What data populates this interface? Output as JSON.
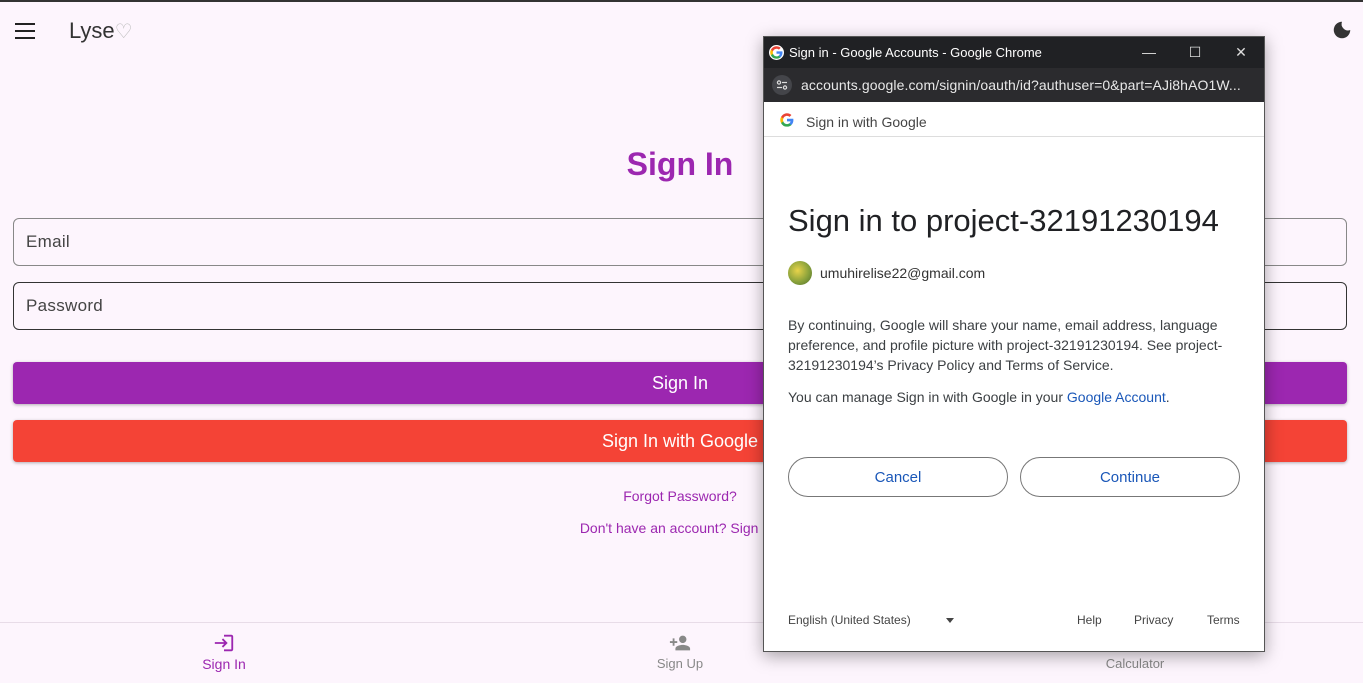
{
  "app": {
    "title": "Lyse",
    "heart": "♡"
  },
  "main": {
    "page_title": "Sign In",
    "email_placeholder": "Email",
    "password_placeholder": "Password",
    "signin_button": "Sign In",
    "google_button": "Sign In with Google",
    "forgot_link": "Forgot Password?",
    "signup_link": "Don't have an account? Sign Up"
  },
  "bottom_nav": {
    "items": [
      {
        "label": "Sign In",
        "icon": "login-icon",
        "active": true
      },
      {
        "label": "Sign Up",
        "icon": "person-add-icon",
        "active": false
      },
      {
        "label": "Calculator",
        "icon": "calculator-icon",
        "active": false
      }
    ]
  },
  "popup": {
    "window_title": "Sign in - Google Accounts - Google Chrome",
    "url": "accounts.google.com/signin/oauth/id?authuser=0&part=AJi8hAO1W...",
    "header": "Sign in with Google",
    "title": "Sign in to project-32191230194",
    "account_email": "umuhirelise22@gmail.com",
    "consent_text": "By continuing, Google will share your name, email address, language preference, and profile picture with project-32191230194. See project-32191230194’s Privacy Policy and Terms of Service.",
    "manage_prefix": "You can manage Sign in with Google in your ",
    "manage_link": "Google Account",
    "manage_suffix": ".",
    "cancel": "Cancel",
    "continue": "Continue",
    "language": "English (United States)",
    "footer_help": "Help",
    "footer_privacy": "Privacy",
    "footer_terms": "Terms"
  },
  "colors": {
    "primary": "#9c27b0",
    "google_red": "#f44336",
    "link_blue": "#1a57b8",
    "background": "#fdf5fd"
  }
}
